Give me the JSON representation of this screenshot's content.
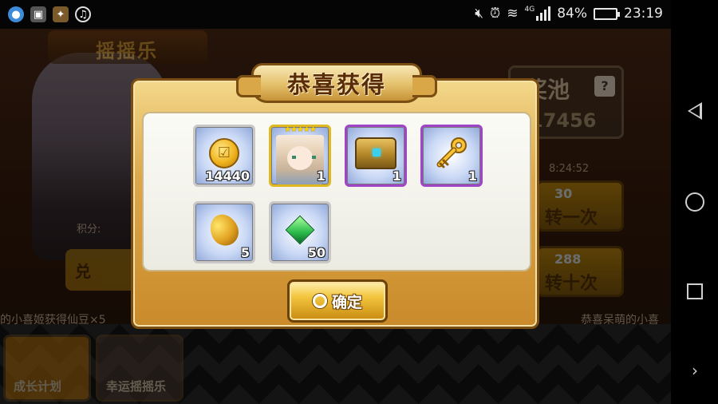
{
  "status_bar": {
    "time": "23:19",
    "battery_percent": "84%",
    "battery_level": 0.84,
    "network": "4G",
    "icons": [
      "app-icon",
      "sim-icon",
      "game-icon",
      "music-icon",
      "mute-icon",
      "alarm-icon",
      "wifi-icon",
      "signal-icon",
      "battery-icon"
    ]
  },
  "game": {
    "banner_title": "摇摇乐",
    "pool": {
      "title": "奖池",
      "help": "?",
      "amount": "17456"
    },
    "timer": "8:24:52",
    "spin_one": {
      "cost": "30",
      "label": "转一次"
    },
    "spin_ten": {
      "cost": "288",
      "label": "转十次"
    },
    "score_label": "积分:",
    "exchange_label": "兑",
    "ticker_left": "的小喜姬获得仙豆×5",
    "ticker_right": "恭喜呆萌的小喜",
    "tiles": {
      "growth_plan": "成长计划",
      "lucky_shake": "幸运摇摇乐"
    }
  },
  "dialog": {
    "title": "恭喜获得",
    "confirm_label": "确定",
    "rewards": [
      {
        "name": "gold-coin",
        "qty": "14440",
        "frame": "silver"
      },
      {
        "name": "hero-card",
        "qty": "1",
        "frame": "gold",
        "stars": "★★★★★"
      },
      {
        "name": "treasure-chest",
        "qty": "1",
        "frame": "purple"
      },
      {
        "name": "golden-key",
        "qty": "1",
        "frame": "purple"
      },
      {
        "name": "magic-bean",
        "qty": "5",
        "frame": "silver"
      },
      {
        "name": "green-gem",
        "qty": "50",
        "frame": "silver"
      }
    ]
  },
  "nav": {
    "back": "back",
    "home": "home",
    "recent": "recent",
    "more": "›"
  },
  "colors": {
    "dialog_gold": "#dca74a",
    "frame_purple": "#a044c8",
    "frame_gold": "#e0b820",
    "title_brown": "#5a2c06"
  }
}
